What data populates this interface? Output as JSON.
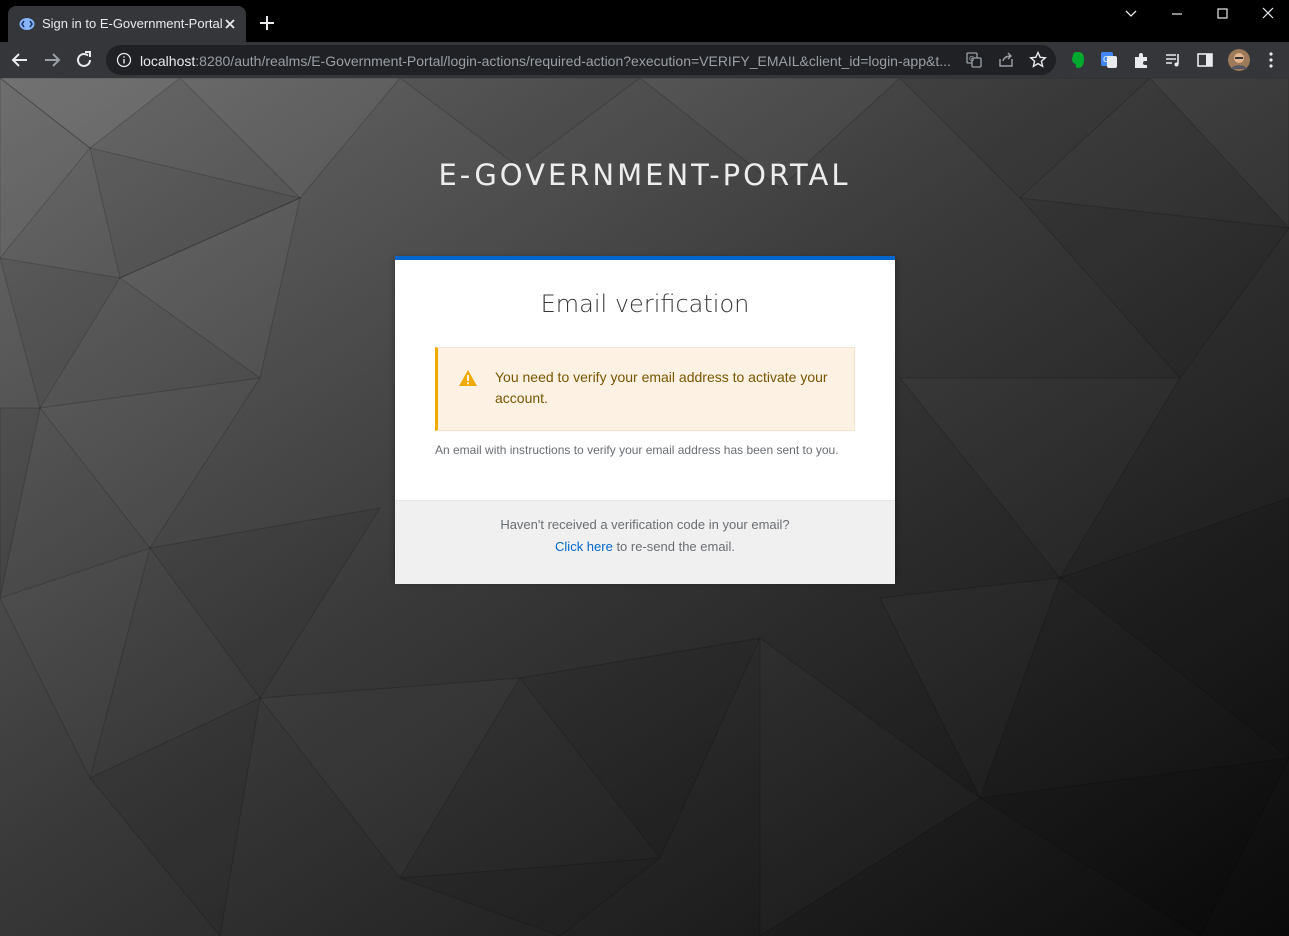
{
  "browser": {
    "tab": {
      "title": "Sign in to E-Government-Portal"
    },
    "address_bar": {
      "host": "localhost",
      "rest": ":8280/auth/realms/E-Government-Portal/login-actions/required-action?execution=VERIFY_EMAIL&client_id=login-app&t..."
    },
    "icons": {
      "back": "arrow-left-icon",
      "forward": "arrow-right-icon",
      "reload": "reload-icon",
      "site_info": "info-icon",
      "translate": "translate-icon",
      "share": "share-icon",
      "bookmark": "star-icon",
      "extensions": [
        "evernote-icon",
        "google-translate-icon",
        "puzzle-icon",
        "media-queue-icon",
        "side-panel-icon",
        "avatar",
        "kebab-menu-icon"
      ]
    }
  },
  "page": {
    "realm_title": "E-GOVERNMENT-PORTAL",
    "card": {
      "heading": "Email verification",
      "alert_text": "You need to verify your email address to activate your account.",
      "instruction": "An email with instructions to verify your email address has been sent to you.",
      "footer": {
        "question": "Haven't received a verification code in your email?",
        "link_label": "Click here",
        "link_suffix": " to re-send the email."
      }
    }
  },
  "colors": {
    "accent": "#0066cc",
    "warning": "#f0ab00",
    "alert_bg": "#fdf1e4",
    "alert_text": "#795600"
  }
}
